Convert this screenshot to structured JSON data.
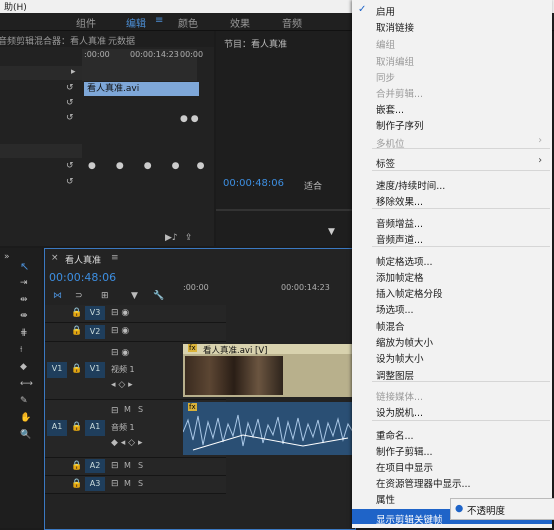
{
  "app": {
    "help_menu": "助(H)"
  },
  "workspaces": [
    "组件",
    "编辑",
    "颜色",
    "效果",
    "音频"
  ],
  "source_panel": {
    "title": "音频剪辑混合器：看人真准",
    "metadata_tab": "元数据",
    "ruler_start": ":00:00",
    "ruler_mid": "00:00:14:23",
    "ruler_end": "00:00",
    "clip_name": "看人真准.avi"
  },
  "program_monitor": {
    "title": "节目：看人真准",
    "timecode": "00:00:48:06",
    "fit": "适合"
  },
  "timeline": {
    "close": "×",
    "sequence_name": "看人真准",
    "timecode": "00:00:48:06",
    "ruler_start": ":00:00",
    "ruler_mid": "00:00:14:23",
    "tracks": [
      {
        "id": "V3",
        "label": ""
      },
      {
        "id": "V2",
        "label": ""
      },
      {
        "id": "V1",
        "label": "视频 1",
        "source": "V1"
      },
      {
        "id": "A1",
        "label": "音频 1",
        "source": "A1"
      },
      {
        "id": "A2",
        "label": ""
      },
      {
        "id": "A3",
        "label": ""
      }
    ],
    "video_clip": "看人真准.avi [V]",
    "fx": "fx",
    "mute": "M",
    "solo": "S"
  },
  "context_menu": {
    "items": [
      {
        "label": "启用",
        "checked": true
      },
      {
        "label": "取消链接"
      },
      {
        "label": "编组",
        "disabled": true
      },
      {
        "label": "取消编组",
        "disabled": true
      },
      {
        "label": "同步",
        "disabled": true
      },
      {
        "label": "合并剪辑...",
        "disabled": true
      },
      {
        "label": "嵌套..."
      },
      {
        "label": "制作子序列"
      },
      {
        "label": "多机位",
        "disabled": true,
        "submenu": true
      },
      {
        "label": "标签",
        "submenu": true
      },
      {
        "label": "速度/持续时间..."
      },
      {
        "label": "移除效果..."
      },
      {
        "label": "音频增益..."
      },
      {
        "label": "音频声道..."
      },
      {
        "label": "帧定格选项..."
      },
      {
        "label": "添加帧定格"
      },
      {
        "label": "插入帧定格分段"
      },
      {
        "label": "场选项..."
      },
      {
        "label": "帧混合"
      },
      {
        "label": "缩放为帧大小"
      },
      {
        "label": "设为帧大小"
      },
      {
        "label": "调整图层"
      },
      {
        "label": "链接媒体...",
        "disabled": true
      },
      {
        "label": "设为脱机..."
      },
      {
        "label": "重命名..."
      },
      {
        "label": "制作子剪辑..."
      },
      {
        "label": "在项目中显示"
      },
      {
        "label": "在资源管理器中显示..."
      },
      {
        "label": "属性"
      },
      {
        "label": "显示剪辑关键帧",
        "submenu": true,
        "highlighted": true
      }
    ],
    "submenu_item": "不透明度"
  },
  "colors": {
    "accent": "#4c8fd6",
    "timecode": "#3d8ee0",
    "menu_highlight": "#1f64c8"
  }
}
